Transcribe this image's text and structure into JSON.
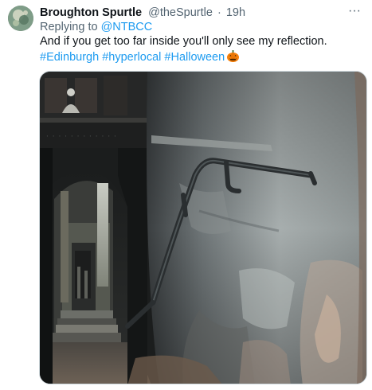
{
  "tweet": {
    "display_name": "Broughton Spurtle",
    "handle": "@theSpurtle",
    "separator": "·",
    "timestamp": "19h",
    "more_label": "···",
    "reply_prefix": "Replying to",
    "reply_to": "@NTBCC",
    "body": "And if you get too far inside you'll only see my reflection.",
    "hashtags": [
      "#Edinburgh",
      "#hyperlocal",
      "#Halloween"
    ],
    "emoji_icon": "jack-o-lantern-icon"
  },
  "colors": {
    "link": "#1d9bf0",
    "secondary_text": "#536471",
    "primary_text": "#0f1419",
    "border": "#cfd9de"
  },
  "media": {
    "kind": "photo",
    "alt": ""
  }
}
